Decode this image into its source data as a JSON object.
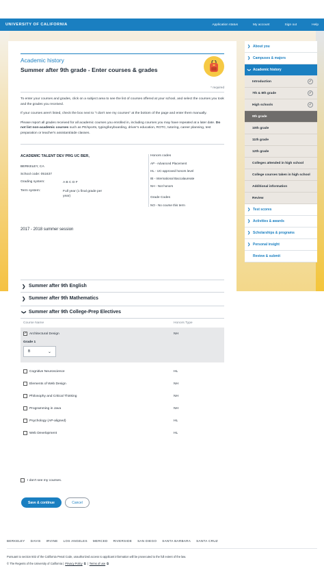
{
  "topbar": {
    "brand": "UNIVERSITY OF CALIFORNIA",
    "nav": [
      "Application status",
      "My account",
      "Sign out",
      "Help"
    ]
  },
  "header": {
    "section": "Academic history",
    "title": "Summer after 9th grade - Enter courses & grades",
    "required": "* required",
    "badge_icon": "backpack-icon"
  },
  "instructions": {
    "p1": "To enter your courses and grades, click on a subject area to see the list of courses offered at your school, and select the courses you took and the grades you received.",
    "p2": "If your courses aren't listed, check the box next to \"I don't see my courses\" at the bottom of the page and enter them manually.",
    "p3_a": "Please report all grades received for all academic courses you enrolled in, including courses you may have repeated at a later date. ",
    "p3_b": "Do not list non-academic courses",
    "p3_c": " such as PE/sports, typing/keyboarding, driver's education, ROTC, tutoring, career planning, test preparation or teacher's assistant/aide classes."
  },
  "school": {
    "name": "ACADEMIC TALENT DEV PRG UC BER,",
    "city": "BERKELEY, CA",
    "code_label": "School code: 051637",
    "grading_label": "Grading system:",
    "grading_value": "A B C D F",
    "term_label": "Term system:",
    "term_value": "Full year (1 final grade per year)"
  },
  "honors": {
    "title": "Honors codes",
    "codes": [
      "AP - Advanced Placement",
      "HL - UC-approved honors level",
      "IB - International Baccalaureate",
      "NH - Not honors"
    ],
    "grade_codes_title": "Grade Codes",
    "grade_codes": [
      "NO - No course this term"
    ]
  },
  "session": "2017 - 2018 summer session",
  "subjects": [
    {
      "label": "Summer after 9th English",
      "expanded": false
    },
    {
      "label": "Summer after 9th Mathematics",
      "expanded": false
    },
    {
      "label": "Summer after 9th College-Prep Electives",
      "expanded": true
    }
  ],
  "courses": {
    "col_course": "Course Name",
    "col_honors": "Honors Type",
    "grade_label": "Grade 1",
    "grade_value": "B",
    "rows": [
      {
        "name": "Architectural Design",
        "honors": "NH",
        "checked": true
      },
      {
        "name": "Cognitive Neuroscience",
        "honors": "HL",
        "checked": false
      },
      {
        "name": "Elements of Web Design",
        "honors": "NH",
        "checked": false
      },
      {
        "name": "Philosophy and Critical Thinking",
        "honors": "NH",
        "checked": false
      },
      {
        "name": "Programming in Java",
        "honors": "NH",
        "checked": false
      },
      {
        "name": "Psychology (AP-aligned)",
        "honors": "HL",
        "checked": false
      },
      {
        "name": "Web Development",
        "honors": "HL",
        "checked": false
      }
    ]
  },
  "not_see": "I don't see my courses.",
  "buttons": {
    "save": "Save & continue",
    "cancel": "Cancel"
  },
  "footer": {
    "campuses": [
      "BERKELEY",
      "DAVIS",
      "IRVINE",
      "LOS ANGELES",
      "MERCED",
      "RIVERSIDE",
      "SAN DIEGO",
      "SANTA BARBARA",
      "SANTA CRUZ"
    ],
    "legal": "Pursuant to section 502 of the California Penal Code, unauthorized access to applicant information will be prosecuted to the full extent of the law.",
    "copyright": "© The Regents of the University of California |",
    "privacy": "Privacy Policy",
    "terms": "Terms of use"
  },
  "sidebar": {
    "about": "About you",
    "campuses": "Campuses & majors",
    "academic": "Academic history",
    "sub": [
      {
        "label": "Introduction",
        "done": true
      },
      {
        "label": "7th & 8th grade",
        "done": true
      },
      {
        "label": "High schools",
        "done": true
      },
      {
        "label": "9th grade",
        "current": true
      },
      {
        "label": "10th grade"
      },
      {
        "label": "11th grade"
      },
      {
        "label": "12th grade"
      },
      {
        "label": "Colleges attended in high school"
      },
      {
        "label": "College courses taken in high school"
      },
      {
        "label": "Additional information"
      },
      {
        "label": "Review"
      }
    ],
    "tests": "Test scores",
    "activities": "Activities & awards",
    "scholarships": "Scholarships & programs",
    "insight": "Personal insight",
    "review": "Review & submit"
  },
  "colors": {
    "accent": "#1a7fc1",
    "badge": "#f6c944",
    "current_sub": "#6f6d6b"
  }
}
